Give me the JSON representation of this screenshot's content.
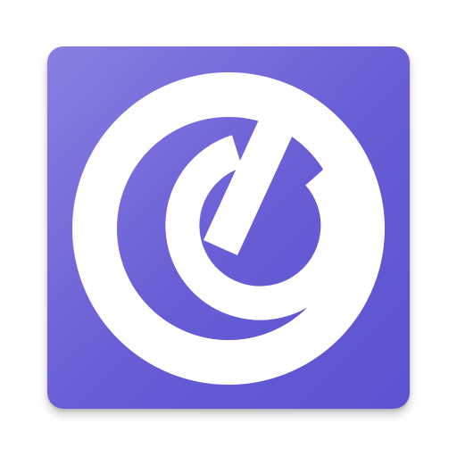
{
  "app_icon": {
    "background_color": "#6a60d6",
    "foreground_color": "#ffffff",
    "glyph": "power-dial-icon"
  }
}
